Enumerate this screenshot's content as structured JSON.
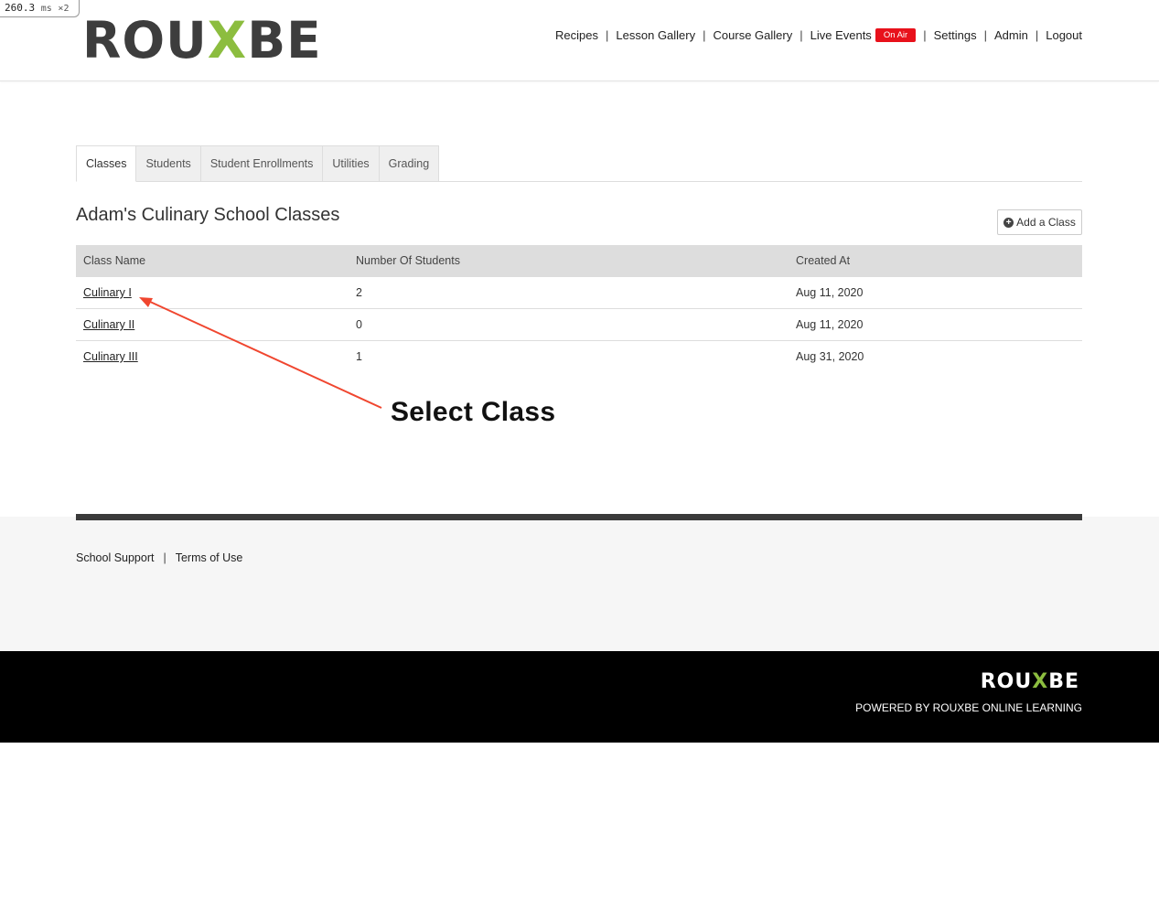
{
  "timer": {
    "value": "260.3",
    "unit": "ms",
    "multiplier": "×2"
  },
  "header": {
    "logo": {
      "part1": "ROU",
      "x": "X",
      "part2": "BE"
    },
    "nav": {
      "recipes": "Recipes",
      "lesson_gallery": "Lesson Gallery",
      "course_gallery": "Course Gallery",
      "live_events": "Live Events",
      "on_air_badge": "On Air",
      "settings": "Settings",
      "admin": "Admin",
      "logout": "Logout",
      "separator": "|"
    }
  },
  "tabs": [
    "Classes",
    "Students",
    "Student Enrollments",
    "Utilities",
    "Grading"
  ],
  "page_title": "Adam's Culinary School Classes",
  "add_button_label": "Add a Class",
  "table": {
    "headers": [
      "Class Name",
      "Number Of Students",
      "Created At"
    ],
    "rows": [
      {
        "name": "Culinary I",
        "students": "2",
        "created": "Aug 11, 2020"
      },
      {
        "name": "Culinary II",
        "students": "0",
        "created": "Aug 11, 2020"
      },
      {
        "name": "Culinary III",
        "students": "1",
        "created": "Aug 31, 2020"
      }
    ]
  },
  "annotation": {
    "label": "Select Class",
    "color": "#f0462f"
  },
  "footer": {
    "school_support": "School Support",
    "terms": "Terms of Use",
    "separator": "|",
    "logo": {
      "part1": "ROU",
      "x": "X",
      "part2": "BE"
    },
    "powered_by": "POWERED BY ROUXBE ONLINE LEARNING"
  },
  "colors": {
    "brand_green": "#8cbd3f",
    "on_air_red": "#e8111b",
    "footer_dark": "#000000"
  }
}
